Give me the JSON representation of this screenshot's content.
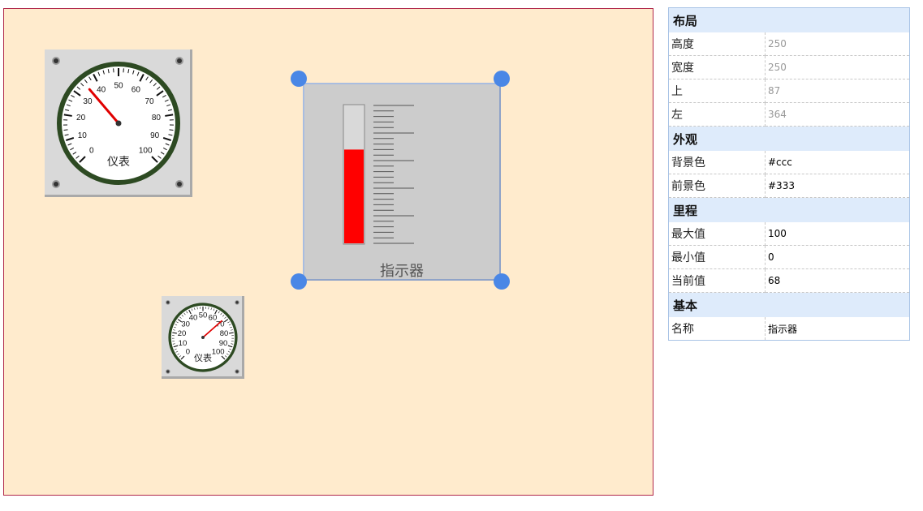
{
  "canvas": {
    "gauge_large": {
      "label": "仪表",
      "ticks": [
        "0",
        "10",
        "20",
        "30",
        "40",
        "50",
        "60",
        "70",
        "80",
        "90",
        "100"
      ],
      "value": 35,
      "min": 0,
      "max": 100
    },
    "gauge_small": {
      "label": "仪表",
      "ticks": [
        "0",
        "10",
        "20",
        "30",
        "40",
        "50",
        "60",
        "70",
        "80",
        "90",
        "100"
      ],
      "value": 68,
      "min": 0,
      "max": 100
    },
    "indicator": {
      "label": "指示器",
      "value": 68,
      "min": 0,
      "max": 100,
      "fill_color": "#ff0000"
    }
  },
  "colors": {
    "canvas_bg": "#ffebcd",
    "gauge_ring": "#2d4a22",
    "needle": "#e00000",
    "handle": "#4a87e6",
    "group_header": "#deebfb"
  },
  "properties": {
    "layout": {
      "header": "布局",
      "height_label": "高度",
      "height_value": "250",
      "width_label": "宽度",
      "width_value": "250",
      "top_label": "上",
      "top_value": "87",
      "left_label": "左",
      "left_value": "364"
    },
    "appearance": {
      "header": "外观",
      "bg_label": "背景色",
      "bg_value": "#ccc",
      "fg_label": "前景色",
      "fg_value": "#333"
    },
    "range": {
      "header": "里程",
      "max_label": "最大值",
      "max_value": "100",
      "min_label": "最小值",
      "min_value": "0",
      "cur_label": "当前值",
      "cur_value": "68"
    },
    "basic": {
      "header": "基本",
      "name_label": "名称",
      "name_value": "指示器"
    }
  }
}
